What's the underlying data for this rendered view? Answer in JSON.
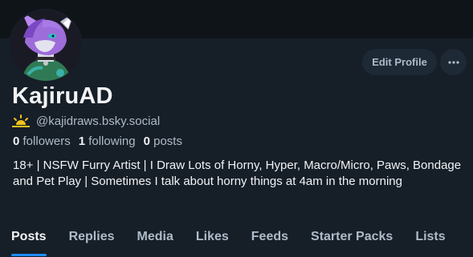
{
  "profile": {
    "display_name": "KajiruAD",
    "handle": "@kajidraws.bsky.social",
    "bio": "18+ | NSFW Furry Artist | I Draw Lots of Horny, Hyper, Macro/Micro, Paws, Bondage and Pet Play | Sometimes I talk about horny things at 4am in the morning"
  },
  "stats": {
    "followers_count": "0",
    "followers_label": "followers",
    "following_count": "1",
    "following_label": "following",
    "posts_count": "0",
    "posts_label": "posts"
  },
  "actions": {
    "edit_profile": "Edit Profile",
    "more": "···"
  },
  "tabs": [
    {
      "label": "Posts",
      "active": true
    },
    {
      "label": "Replies"
    },
    {
      "label": "Media"
    },
    {
      "label": "Likes"
    },
    {
      "label": "Feeds"
    },
    {
      "label": "Starter Packs"
    },
    {
      "label": "Lists"
    }
  ],
  "colors": {
    "background": "#161e27",
    "banner": "#0f1419",
    "accent": "#208bfe",
    "text_primary": "#f1f3f5",
    "text_secondary": "#aebbc9",
    "button_bg": "#1e2936"
  },
  "icons": {
    "handle_badge": "sun-icon",
    "more": "more-dots-icon"
  }
}
